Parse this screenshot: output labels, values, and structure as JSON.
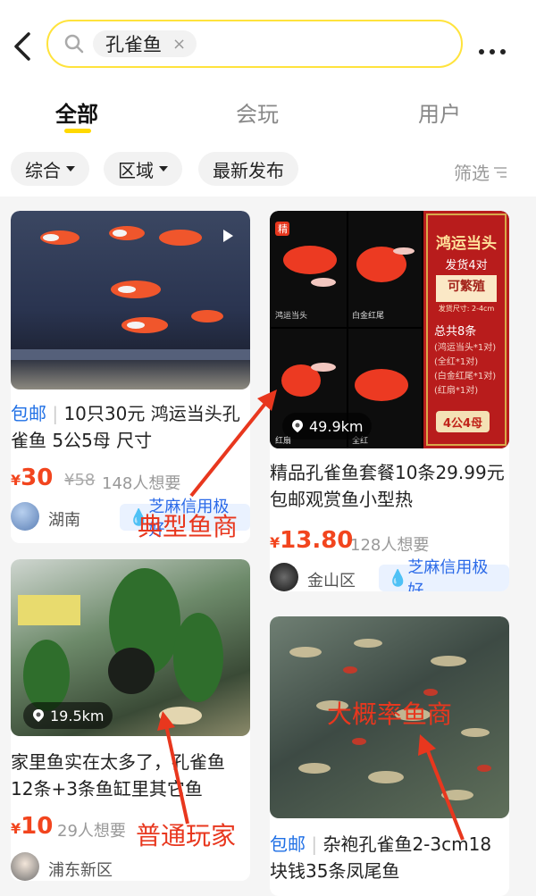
{
  "search": {
    "query": "孔雀鱼",
    "clear": "×"
  },
  "tabs": [
    "全部",
    "会玩",
    "用户"
  ],
  "filters": {
    "sort": "综合",
    "region": "区域",
    "latest": "最新发布",
    "filter": "筛选"
  },
  "cards": [
    {
      "tag": "包邮",
      "title": "10只30元 鸿运当头孔雀鱼 5公5母 尺寸",
      "price_symbol": "¥",
      "price": "30",
      "original": "¥58",
      "wants": "148人想要",
      "location": "湖南",
      "credit": "芝麻信用极好"
    },
    {
      "badge": "精",
      "title": "精品孔雀鱼套餐10条29.99元包邮观赏鱼小型热",
      "price_symbol": "¥",
      "price": "13.80",
      "wants": "128人想要",
      "location": "金山区",
      "credit": "芝麻信用极好",
      "distance": "49.9km",
      "promo": {
        "title": "鸿运当头",
        "ship": "发货4对",
        "breed": "可繁殖",
        "size": "发货尺寸: 2-4cm",
        "total": "总共8条",
        "lines": [
          "(鸿运当头*1对)",
          "(全红*1对)",
          "(白金红尾*1对)",
          "(红扇*1对)"
        ],
        "badge": "4公4母"
      },
      "cells": [
        "鸿运当头",
        "白金红尾",
        "红扇",
        "全红"
      ]
    },
    {
      "title": "家里鱼实在太多了，孔雀鱼12条+3条鱼缸里其它鱼",
      "price_symbol": "¥",
      "price": "10",
      "wants": "29人想要",
      "location": "浦东新区",
      "distance": "19.5km"
    },
    {
      "tag": "包邮",
      "title": "杂袍孔雀鱼2-3cm18块钱35条凤尾鱼"
    }
  ],
  "annotations": {
    "dealer": "典型鱼商",
    "likely": "大概率鱼商",
    "player": "普通玩家"
  },
  "colors": {
    "accent": "#ffd900",
    "price": "#f2451e",
    "tag": "#1f6fe5",
    "annotation": "#e8371e"
  }
}
